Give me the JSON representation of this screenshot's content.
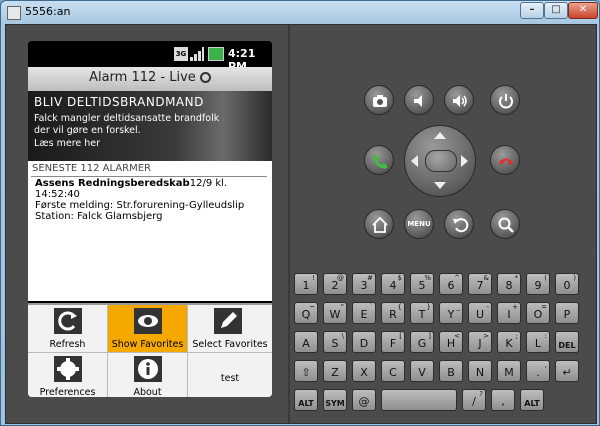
{
  "window": {
    "title": "5556:an"
  },
  "phone": {
    "status": {
      "network": "3G",
      "time": "4:21 PM"
    },
    "app_title": "Alarm 112 - Live",
    "banner": {
      "headline": "BLIV DELTIDSBRANDMAND",
      "line1": "Falck mangler deltidsansatte brandfolk",
      "line2": "der vil gøre en forskel.",
      "line3": "Læs mere her"
    },
    "section_header": "SENESTE 112 ALARMER",
    "alarm": {
      "name": "Assens Redningsberedskab",
      "datetime": "12/9 kl. 14:52:40",
      "first_report": "Første melding: Str.forurening-Gylleudslip",
      "station": "Station: Falck Glamsbjerg"
    },
    "menu": [
      {
        "label": "Refresh",
        "icon": "refresh-icon",
        "selected": false
      },
      {
        "label": "Show Favorites",
        "icon": "eye-icon",
        "selected": true
      },
      {
        "label": "Select Favorites",
        "icon": "pencil-icon",
        "selected": false
      },
      {
        "label": "Preferences",
        "icon": "gear-icon",
        "selected": false
      },
      {
        "label": "About",
        "icon": "info-icon",
        "selected": false
      },
      {
        "label": "test",
        "icon": "",
        "selected": false
      }
    ]
  },
  "hardware": {
    "menu_label": "MENU"
  },
  "keyboard": {
    "row1": [
      {
        "main": "1",
        "alt": "!"
      },
      {
        "main": "2",
        "alt": "@"
      },
      {
        "main": "3",
        "alt": "#"
      },
      {
        "main": "4",
        "alt": "$"
      },
      {
        "main": "5",
        "alt": "%"
      },
      {
        "main": "6",
        "alt": "^"
      },
      {
        "main": "7",
        "alt": "&"
      },
      {
        "main": "8",
        "alt": "*"
      },
      {
        "main": "9",
        "alt": "("
      },
      {
        "main": "0",
        "alt": ")"
      }
    ],
    "row2": [
      {
        "main": "Q",
        "alt": "~"
      },
      {
        "main": "W",
        "alt": "\""
      },
      {
        "main": "E",
        "alt": "`"
      },
      {
        "main": "R",
        "alt": "{"
      },
      {
        "main": "T",
        "alt": "}"
      },
      {
        "main": "Y",
        "alt": "_"
      },
      {
        "main": "U",
        "alt": "-"
      },
      {
        "main": "I",
        "alt": "+"
      },
      {
        "main": "O",
        "alt": "="
      },
      {
        "main": "P",
        "alt": ""
      }
    ],
    "row3": [
      {
        "main": "A",
        "alt": ""
      },
      {
        "main": "S",
        "alt": "\\"
      },
      {
        "main": "D",
        "alt": ""
      },
      {
        "main": "F",
        "alt": "["
      },
      {
        "main": "G",
        "alt": "]"
      },
      {
        "main": "H",
        "alt": "<"
      },
      {
        "main": "J",
        "alt": ">"
      },
      {
        "main": "K",
        "alt": ";"
      },
      {
        "main": "L",
        "alt": ":"
      },
      {
        "main": "DEL",
        "alt": ""
      }
    ],
    "row4": [
      {
        "main": "⇧",
        "alt": ""
      },
      {
        "main": "Z",
        "alt": ""
      },
      {
        "main": "X",
        "alt": ""
      },
      {
        "main": "C",
        "alt": ""
      },
      {
        "main": "V",
        "alt": ""
      },
      {
        "main": "B",
        "alt": ""
      },
      {
        "main": "N",
        "alt": ""
      },
      {
        "main": "M",
        "alt": ""
      },
      {
        "main": ".",
        "alt": ","
      },
      {
        "main": "↵",
        "alt": ""
      }
    ],
    "row5": [
      {
        "main": "ALT",
        "alt": ""
      },
      {
        "main": "SYM",
        "alt": ""
      },
      {
        "main": "@",
        "alt": ""
      },
      {
        "main": "",
        "alt": ""
      },
      {
        "main": "/",
        "alt": "?"
      },
      {
        "main": ",",
        "alt": ""
      },
      {
        "main": "ALT",
        "alt": ""
      }
    ]
  }
}
